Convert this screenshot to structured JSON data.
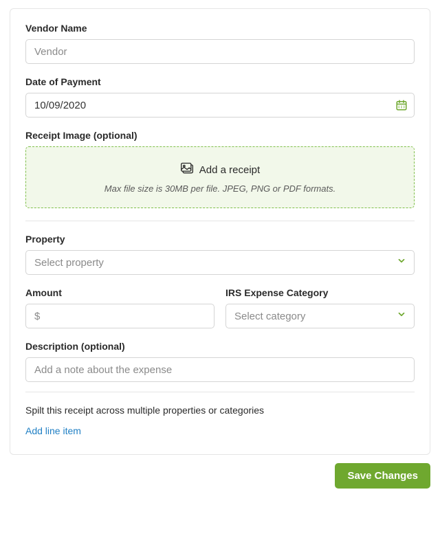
{
  "vendor": {
    "label": "Vendor Name",
    "placeholder": "Vendor",
    "value": ""
  },
  "date": {
    "label": "Date of Payment",
    "value": "10/09/2020"
  },
  "receipt": {
    "label": "Receipt Image (optional)",
    "dropzone_title": "Add a receipt",
    "dropzone_sub": "Max file size is 30MB per file. JPEG, PNG or PDF formats."
  },
  "property": {
    "label": "Property",
    "placeholder": "Select property"
  },
  "amount": {
    "label": "Amount",
    "placeholder": "$"
  },
  "irs_category": {
    "label": "IRS Expense Category",
    "placeholder": "Select category"
  },
  "description": {
    "label": "Description (optional)",
    "placeholder": "Add a note about the expense"
  },
  "split": {
    "text": "Spilt this receipt across multiple properties or categories",
    "link": "Add line item"
  },
  "actions": {
    "save": "Save Changes"
  },
  "colors": {
    "accent_green": "#6fa82f",
    "link_blue": "#1f7fc4"
  }
}
